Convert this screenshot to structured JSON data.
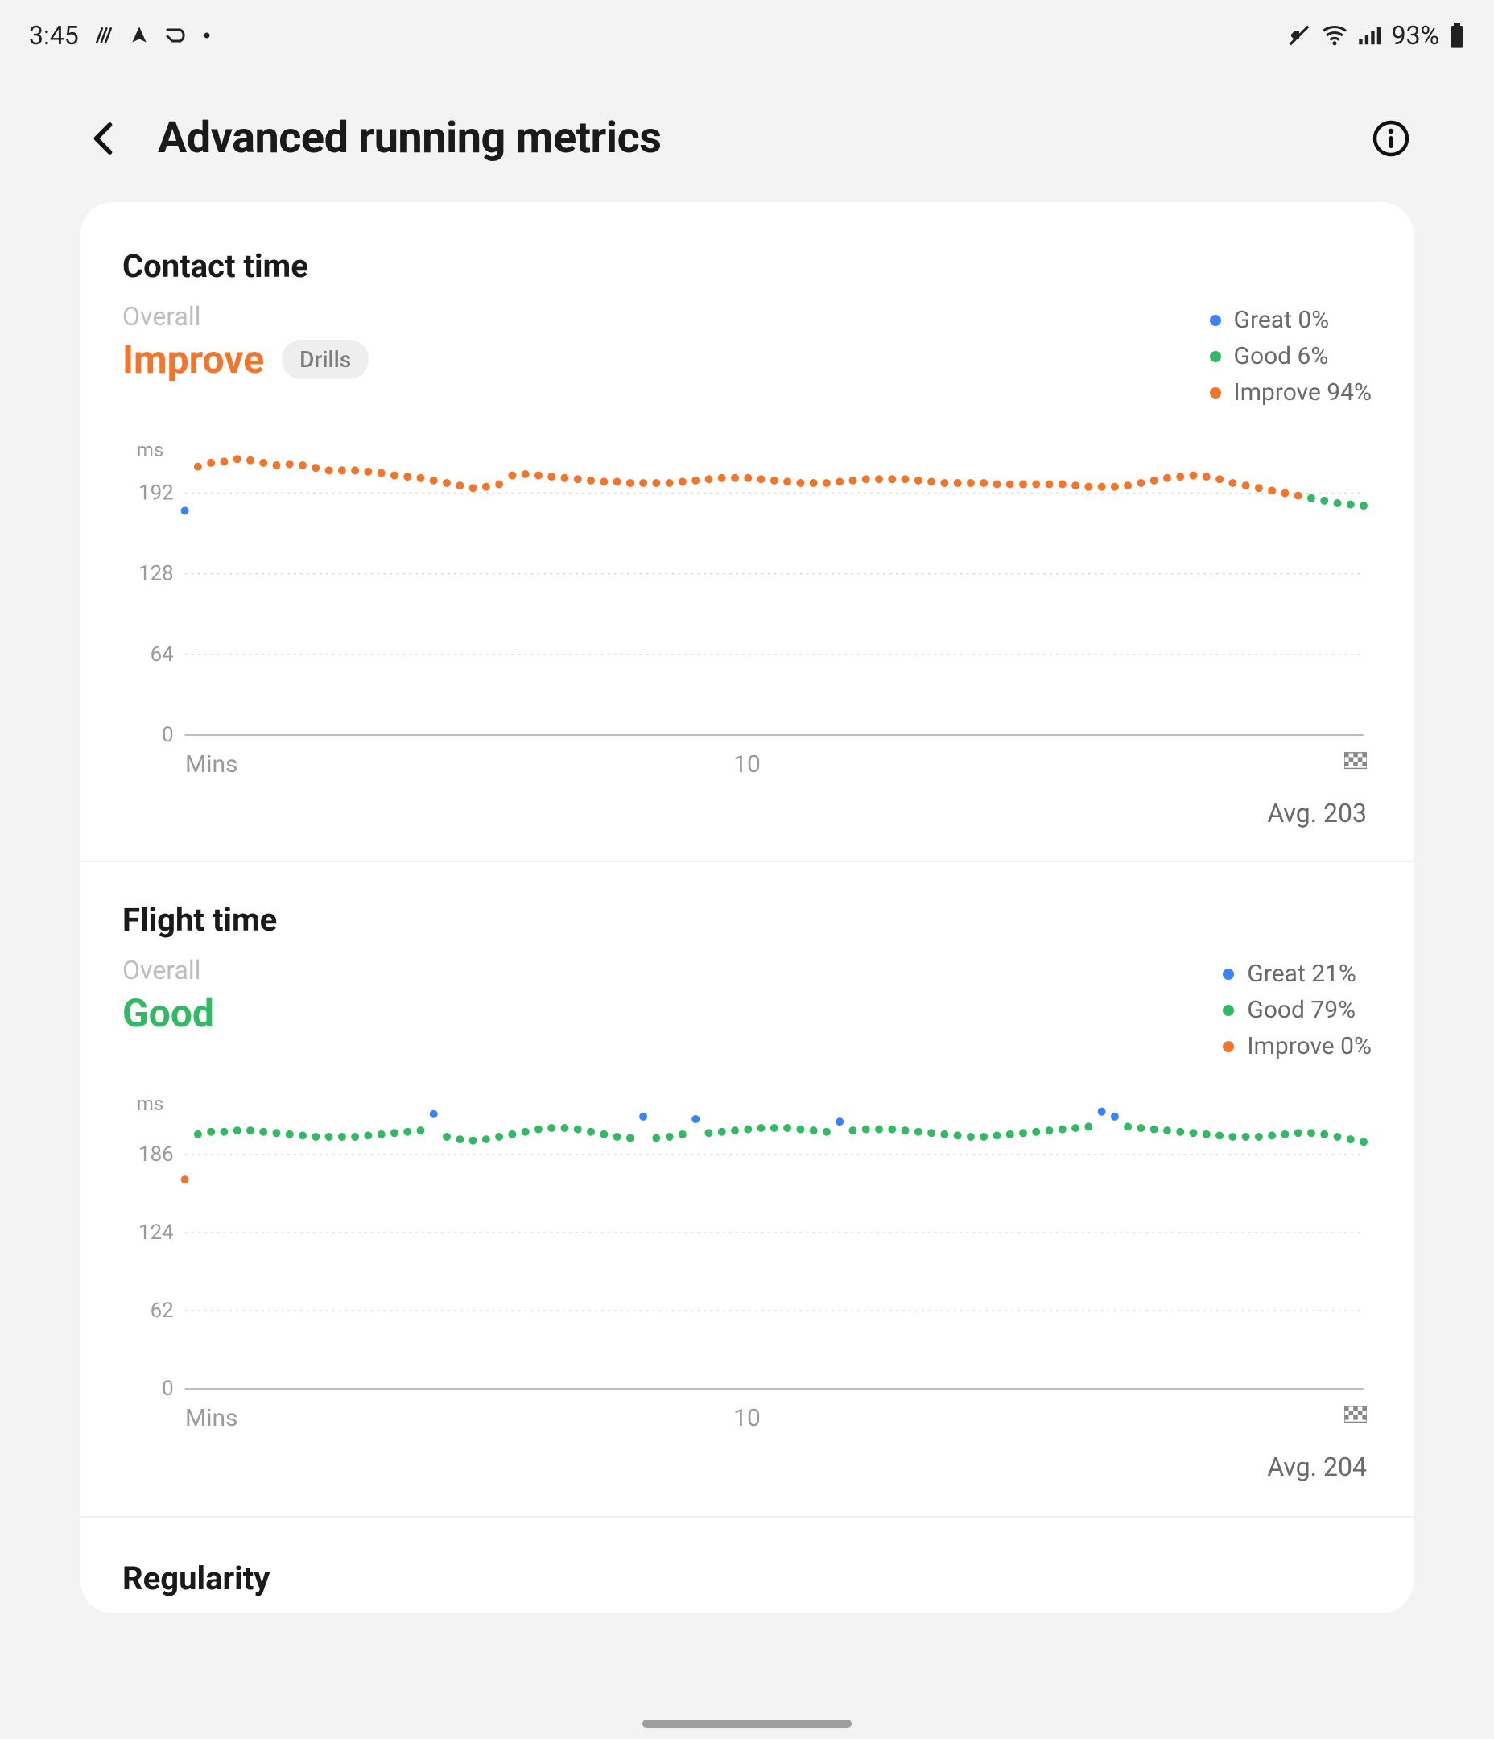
{
  "status": {
    "time": "3:45",
    "battery_pct": "93%"
  },
  "header": {
    "title": "Advanced running metrics"
  },
  "sections": [
    {
      "id": "contact",
      "title": "Contact time",
      "overall_label": "Overall",
      "overall_value": "Improve",
      "overall_class": "improve",
      "drills_label": "Drills",
      "show_drills": true,
      "legend": {
        "great": "Great 0%",
        "good": "Good 6%",
        "improve": "Improve 94%"
      },
      "y_unit": "ms",
      "y_ticks": [
        "192",
        "128",
        "64",
        "0"
      ],
      "x_label": "Mins",
      "x_mid": "10",
      "avg_label": "Avg. 203"
    },
    {
      "id": "flight",
      "title": "Flight time",
      "overall_label": "Overall",
      "overall_value": "Good",
      "overall_class": "good",
      "show_drills": false,
      "legend": {
        "great": "Great 21%",
        "good": "Good 79%",
        "improve": "Improve 0%"
      },
      "y_unit": "ms",
      "y_ticks": [
        "186",
        "124",
        "62",
        "0"
      ],
      "x_label": "Mins",
      "x_mid": "10",
      "avg_label": "Avg. 204"
    }
  ],
  "peek_title": "Regularity",
  "chart_data": [
    {
      "section": "contact",
      "type": "scatter",
      "title": "Contact time",
      "xlabel": "Mins",
      "ylabel": "ms",
      "ylim": [
        0,
        230
      ],
      "y_ticks": [
        0,
        64,
        128,
        192
      ],
      "avg": 203,
      "legend": {
        "Great": "0%",
        "Good": "6%",
        "Improve": "94%"
      },
      "colors": {
        "great": "#3b82f6",
        "good": "#33b864",
        "improve": "#f2752c"
      },
      "series": [
        {
          "name": "Great",
          "x": [
            0.2
          ],
          "y": [
            178
          ]
        },
        {
          "name": "Improve",
          "x": [
            0.4,
            0.6,
            0.8,
            1.0,
            1.2,
            1.4,
            1.6,
            1.8,
            2.0,
            2.2,
            2.4,
            2.6,
            2.8,
            3.0,
            3.2,
            3.4,
            3.6,
            3.8,
            4.0,
            4.2,
            4.4,
            4.6,
            4.8,
            5.0,
            5.2,
            5.4,
            5.6,
            5.8,
            6.0,
            6.2,
            6.4,
            6.6,
            6.8,
            7.0,
            7.2,
            7.4,
            7.6,
            7.8,
            8.0,
            8.2,
            8.4,
            8.6,
            8.8,
            9.0,
            9.2,
            9.4,
            9.6,
            9.8,
            10.0,
            10.2,
            10.4,
            10.6,
            10.8,
            11.0,
            11.2,
            11.4,
            11.6,
            11.8,
            12.0,
            12.2,
            12.4,
            12.6,
            12.8,
            13.0,
            13.2,
            13.4,
            13.6,
            13.8,
            14.0,
            14.2,
            14.4,
            14.6,
            14.8,
            15.0,
            15.2,
            15.4,
            15.6,
            15.8,
            16.0,
            16.2,
            16.4,
            16.6,
            16.8,
            17.0,
            17.2
          ],
          "y": [
            213,
            216,
            217,
            219,
            218,
            216,
            214,
            215,
            214,
            212,
            210,
            210,
            210,
            209,
            208,
            206,
            205,
            204,
            202,
            200,
            198,
            196,
            197,
            199,
            206,
            207,
            206,
            205,
            204,
            203,
            202,
            201,
            201,
            200,
            200,
            200,
            200,
            201,
            202,
            203,
            204,
            204,
            204,
            203,
            202,
            201,
            200,
            200,
            200,
            201,
            202,
            203,
            203,
            203,
            203,
            202,
            201,
            200,
            200,
            200,
            200,
            199,
            199,
            199,
            199,
            199,
            199,
            198,
            197,
            197,
            197,
            198,
            200,
            202,
            204,
            205,
            206,
            205,
            203,
            200,
            198,
            196,
            194,
            192,
            190
          ]
        },
        {
          "name": "Good",
          "x": [
            17.4,
            17.6,
            17.8,
            18.0,
            18.2
          ],
          "y": [
            188,
            186,
            184,
            183,
            182
          ]
        }
      ]
    },
    {
      "section": "flight",
      "type": "scatter",
      "title": "Flight time",
      "xlabel": "Mins",
      "ylabel": "ms",
      "ylim": [
        0,
        230
      ],
      "y_ticks": [
        0,
        62,
        124,
        186
      ],
      "avg": 204,
      "legend": {
        "Great": "21%",
        "Good": "79%",
        "Improve": "0%"
      },
      "colors": {
        "great": "#3b82f6",
        "good": "#33b864",
        "improve": "#f2752c"
      },
      "series": [
        {
          "name": "Improve",
          "x": [
            0.2
          ],
          "y": [
            166
          ]
        },
        {
          "name": "Good",
          "x": [
            0.4,
            0.6,
            0.8,
            1.0,
            1.2,
            1.4,
            1.6,
            1.8,
            2.0,
            2.2,
            2.4,
            2.6,
            2.8,
            3.0,
            3.2,
            3.4,
            3.6,
            3.8,
            4.2,
            4.4,
            4.6,
            4.8,
            5.0,
            5.2,
            5.4,
            5.6,
            5.8,
            6.0,
            6.2,
            6.4,
            6.6,
            6.8,
            7.0,
            7.4,
            7.6,
            7.8,
            8.2,
            8.4,
            8.6,
            8.8,
            9.0,
            9.2,
            9.4,
            9.6,
            9.8,
            10.0,
            10.4,
            10.6,
            10.8,
            11.0,
            11.2,
            11.4,
            11.6,
            11.8,
            12.0,
            12.2,
            12.4,
            12.6,
            12.8,
            13.0,
            13.2,
            13.4,
            13.6,
            13.8,
            14.0,
            14.6,
            14.8,
            15.0,
            15.2,
            15.4,
            15.6,
            15.8,
            16.0,
            16.2,
            16.4,
            16.6,
            16.8,
            17.0,
            17.2,
            17.4,
            17.6,
            17.8,
            18.0,
            18.2
          ],
          "y": [
            202,
            204,
            204,
            205,
            205,
            204,
            203,
            202,
            201,
            200,
            200,
            200,
            200,
            201,
            202,
            203,
            204,
            205,
            200,
            198,
            197,
            198,
            200,
            202,
            204,
            206,
            207,
            207,
            206,
            204,
            202,
            200,
            199,
            199,
            200,
            202,
            203,
            204,
            205,
            206,
            207,
            207,
            207,
            206,
            205,
            204,
            205,
            206,
            206,
            206,
            205,
            204,
            203,
            202,
            201,
            200,
            200,
            201,
            202,
            203,
            204,
            205,
            206,
            207,
            208,
            208,
            207,
            206,
            205,
            204,
            203,
            202,
            201,
            200,
            200,
            200,
            201,
            202,
            203,
            203,
            202,
            200,
            198,
            196
          ]
        },
        {
          "name": "Great",
          "x": [
            4.0,
            7.2,
            8.0,
            10.2,
            14.2,
            14.4
          ],
          "y": [
            218,
            216,
            214,
            212,
            220,
            216
          ]
        }
      ]
    }
  ]
}
